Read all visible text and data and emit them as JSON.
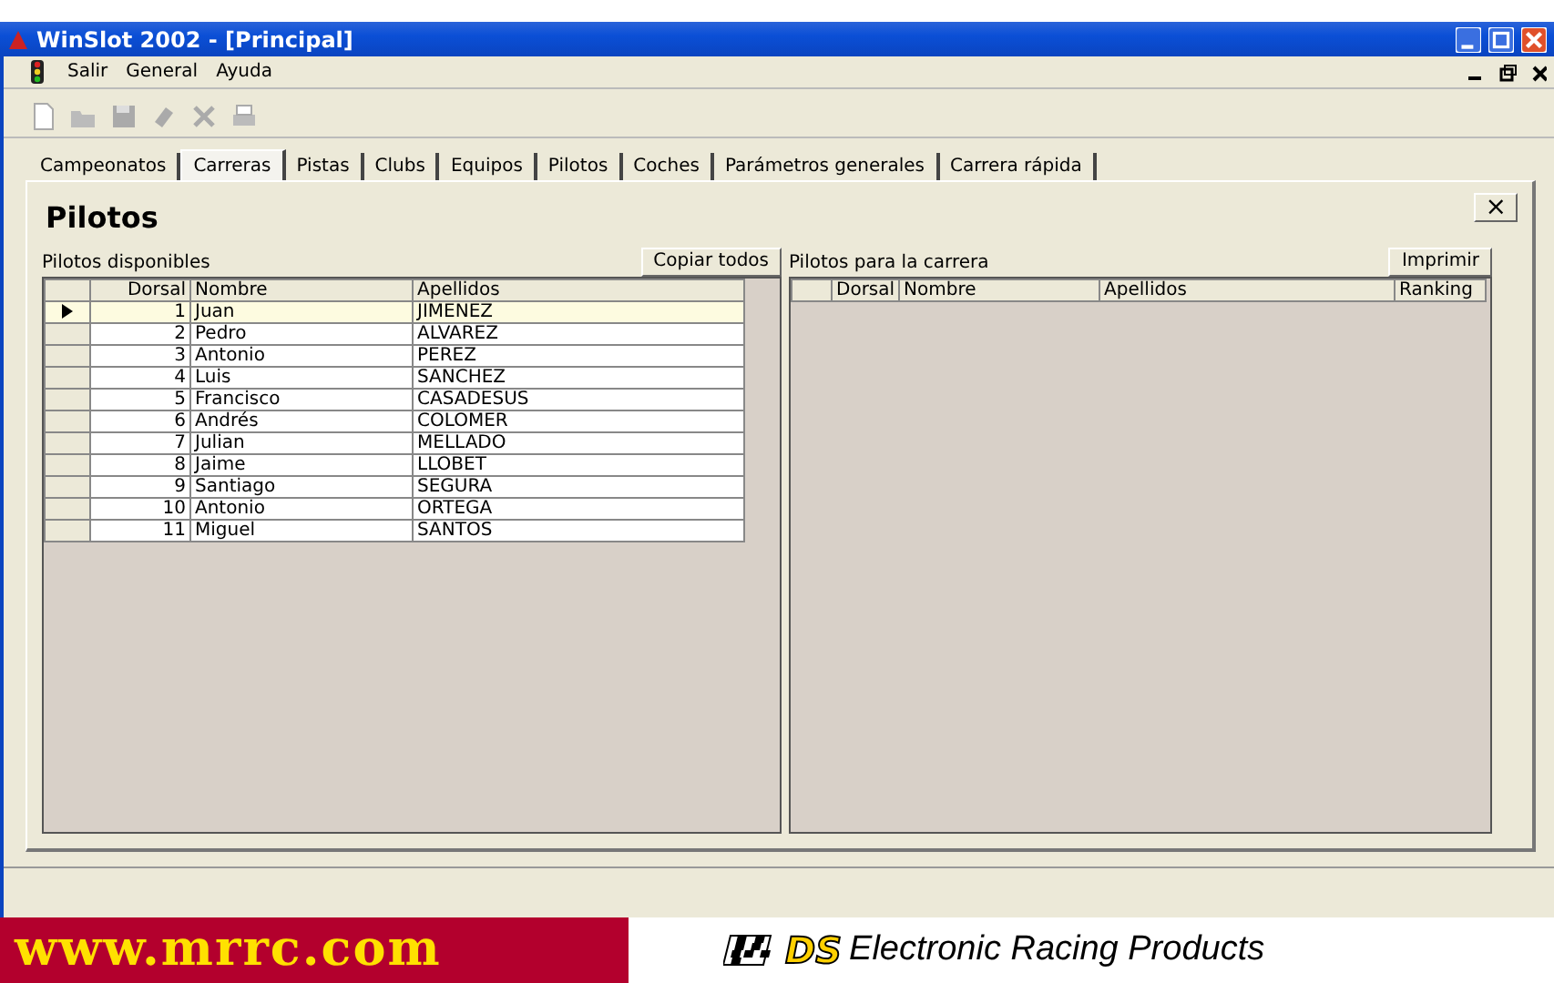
{
  "window": {
    "title": "WinSlot 2002 - [Principal]"
  },
  "menu": [
    "Salir",
    "General",
    "Ayuda"
  ],
  "toolbar": [
    {
      "kind": "new"
    },
    {
      "kind": "open"
    },
    {
      "kind": "save"
    },
    {
      "kind": "erase"
    },
    {
      "kind": "delete"
    },
    {
      "kind": "print"
    }
  ],
  "tabs": [
    {
      "label": "Campeonatos",
      "selected": false
    },
    {
      "label": "Carreras",
      "selected": true
    },
    {
      "label": "Pistas",
      "selected": false
    },
    {
      "label": "Clubs",
      "selected": false
    },
    {
      "label": "Equipos",
      "selected": false
    },
    {
      "label": "Pilotos",
      "selected": false
    },
    {
      "label": "Coches",
      "selected": false
    },
    {
      "label": "Parámetros generales",
      "selected": false
    },
    {
      "label": "Carrera rápida",
      "selected": false
    }
  ],
  "panel": {
    "title": "Pilotos",
    "close": "×"
  },
  "available": {
    "label": "Pilotos disponibles",
    "button": "Copiar todos",
    "columns": [
      "Dorsal",
      "Nombre",
      "Apellidos"
    ],
    "rows": [
      {
        "cells": [
          "1",
          "Juan",
          "JIMENEZ"
        ],
        "selected": true
      },
      {
        "cells": [
          "2",
          "Pedro",
          "ALVAREZ"
        ],
        "selected": false
      },
      {
        "cells": [
          "3",
          "Antonio",
          "PEREZ"
        ],
        "selected": false
      },
      {
        "cells": [
          "4",
          "Luis",
          "SANCHEZ"
        ],
        "selected": false
      },
      {
        "cells": [
          "5",
          "Francisco",
          "CASADESUS"
        ],
        "selected": false
      },
      {
        "cells": [
          "6",
          "Andrés",
          "COLOMER"
        ],
        "selected": false
      },
      {
        "cells": [
          "7",
          "Julian",
          "MELLADO"
        ],
        "selected": false
      },
      {
        "cells": [
          "8",
          "Jaime",
          "LLOBET"
        ],
        "selected": false
      },
      {
        "cells": [
          "9",
          "Santiago",
          "SEGURA"
        ],
        "selected": false
      },
      {
        "cells": [
          "10",
          "Antonio",
          "ORTEGA"
        ],
        "selected": false
      },
      {
        "cells": [
          "11",
          "Miguel",
          "SANTOS"
        ],
        "selected": false
      }
    ]
  },
  "race": {
    "label": "Pilotos para la carrera",
    "button": "Imprimir",
    "columns": [
      "Dorsal",
      "Nombre",
      "Apellidos",
      "Ranking"
    ]
  },
  "banner": {
    "site": "www.mrrc.com",
    "brand": "DS",
    "tagline": "Electronic Racing Products"
  }
}
